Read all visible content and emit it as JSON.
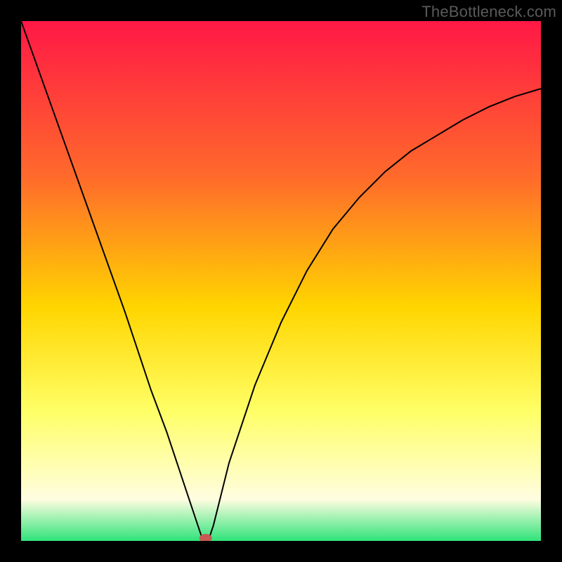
{
  "watermark": "TheBottleneck.com",
  "chart_data": {
    "type": "line",
    "title": "",
    "xlabel": "",
    "ylabel": "",
    "xlim": [
      0,
      100
    ],
    "ylim": [
      0,
      100
    ],
    "background_gradient": {
      "top": "#ff1846",
      "mid1": "#ff6a2b",
      "mid2": "#ffd500",
      "mid3": "#ffff66",
      "mid4": "#fffde0",
      "bottom": "#2fe37a"
    },
    "series": [
      {
        "name": "bottleneck-curve",
        "stroke": "#000000",
        "stroke_width": 2,
        "x": [
          0,
          5,
          10,
          15,
          20,
          25,
          28,
          30,
          32,
          34,
          35,
          36,
          37,
          38,
          40,
          45,
          50,
          55,
          60,
          65,
          70,
          75,
          80,
          85,
          90,
          95,
          100
        ],
        "values": [
          100,
          86,
          72,
          58,
          44,
          29,
          21,
          15,
          9,
          3,
          0,
          0,
          3,
          7,
          15,
          30,
          42,
          52,
          60,
          66,
          71,
          75,
          78,
          81,
          83.5,
          85.5,
          87
        ]
      }
    ],
    "marker": {
      "name": "min-point",
      "x": 35.5,
      "y": 0,
      "color": "#c75a52",
      "rx": 9,
      "ry": 6
    }
  }
}
